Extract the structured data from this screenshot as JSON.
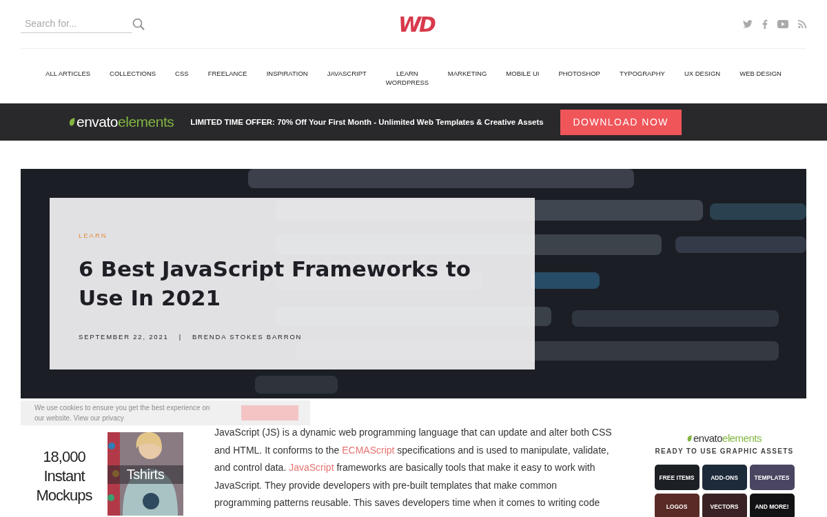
{
  "header": {
    "search": {
      "placeholder": "Search for..."
    },
    "logo_text": "WD"
  },
  "nav": [
    {
      "label": "ALL ARTICLES"
    },
    {
      "label": "COLLECTIONS"
    },
    {
      "label": "CSS"
    },
    {
      "label": "FREELANCE"
    },
    {
      "label": "INSPIRATION"
    },
    {
      "label": "JAVASCRIPT"
    },
    {
      "label": "LEARN WORDPRESS"
    },
    {
      "label": "MARKETING"
    },
    {
      "label": "MOBILE UI"
    },
    {
      "label": "PHOTOSHOP"
    },
    {
      "label": "TYPOGRAPHY"
    },
    {
      "label": "UX DESIGN"
    },
    {
      "label": "WEB DESIGN"
    }
  ],
  "promo": {
    "brand_primary": "envato",
    "brand_secondary": "elements",
    "offer": "LIMITED TIME OFFER: 70% Off Your First Month - Unlimited Web Templates & Creative Assets",
    "button": "DOWNLOAD NOW"
  },
  "hero": {
    "category": "LEARN",
    "title": "6 Best JavaScript Frameworks to Use In 2021",
    "date": "SEPTEMBER 22, 2021",
    "separator": "|",
    "author": "BRENDA STOKES BARRON"
  },
  "ad": {
    "headline": [
      "18,000",
      "Instant",
      "Mockups"
    ],
    "label": "Tshirts"
  },
  "article": {
    "segments": [
      {
        "kind": "text",
        "text": "JavaScript (JS) is a dynamic web programming language that can update and alter both CSS and HTML. It conforms to the "
      },
      {
        "kind": "link",
        "text": "ECMAScript"
      },
      {
        "kind": "text",
        "text": " specifications and is used to manipulate, validate, and control data. "
      },
      {
        "kind": "link",
        "text": "JavaScript"
      },
      {
        "kind": "text",
        "text": " frameworks are basically tools that make it easy to work with JavaScript. They provide developers with pre-built templates that make common programming patterns reusable. This saves developers time when it comes to writing code"
      }
    ]
  },
  "cookie": {
    "lines": [
      "We use cookies to ensure you get the best experience on",
      "our website. View our privacy"
    ]
  },
  "sidebar": {
    "brand_primary": "envato",
    "brand_secondary": "elements",
    "tagline": "READY TO USE GRAPHIC ASSETS",
    "tiles": [
      {
        "label": "FREE ITEMS",
        "color": "#1c1f24"
      },
      {
        "label": "ADD-ONS",
        "color": "#1d2a3a"
      },
      {
        "label": "TEMPLATES",
        "color": "#4a4560"
      },
      {
        "label": "LOGOS",
        "color": "#5a2a26"
      },
      {
        "label": "VECTORS",
        "color": "#3a2224"
      },
      {
        "label": "AND MORE!",
        "color": "#121214"
      }
    ]
  }
}
